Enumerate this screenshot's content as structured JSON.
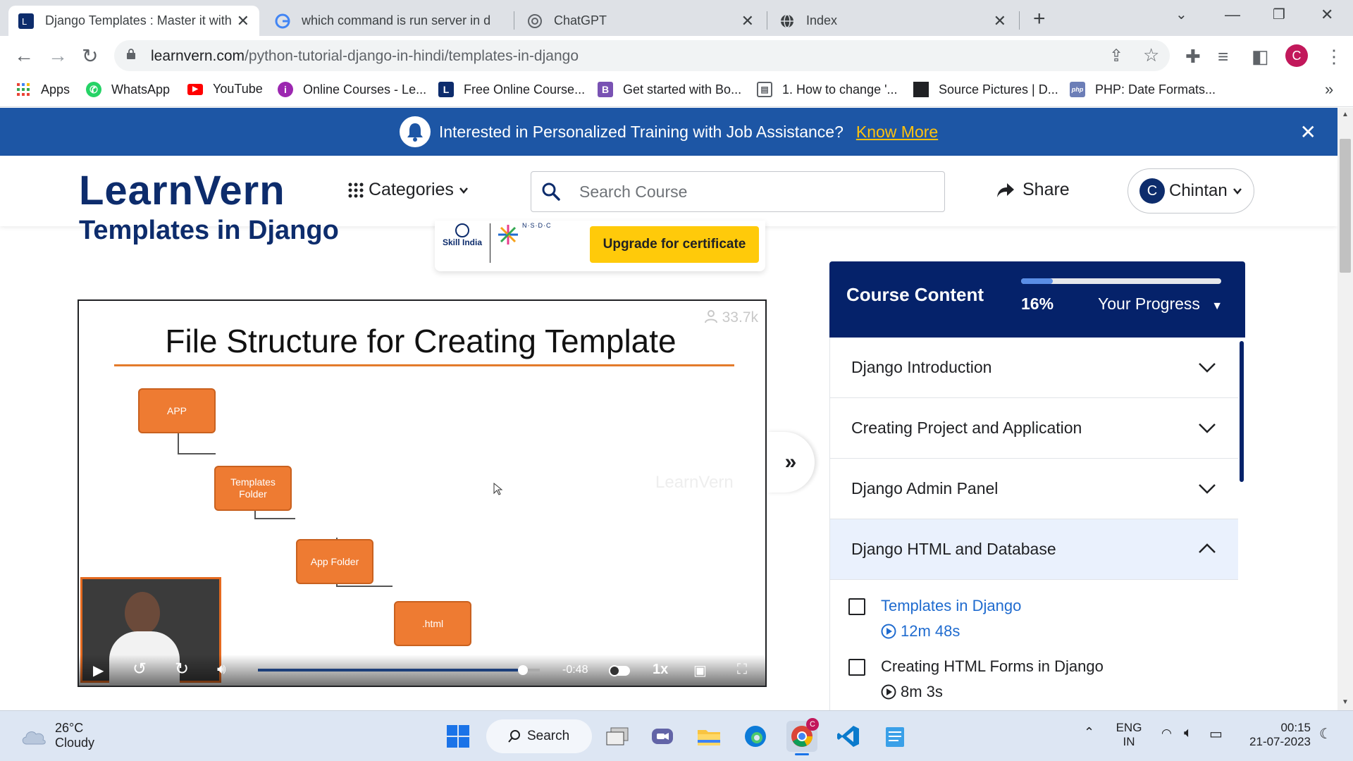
{
  "browser": {
    "tabs": [
      {
        "title": "Django Templates : Master it with",
        "active": true
      },
      {
        "title": "which command is run server in d",
        "active": false
      },
      {
        "title": "ChatGPT",
        "active": false
      },
      {
        "title": "Index",
        "active": false
      }
    ],
    "url_host": "learnvern.com",
    "url_path": "/python-tutorial-django-in-hindi/templates-in-django",
    "profile_initial": "C",
    "bookmarks": [
      {
        "label": "Apps"
      },
      {
        "label": "WhatsApp"
      },
      {
        "label": "YouTube"
      },
      {
        "label": "Online Courses - Le..."
      },
      {
        "label": "Free Online Course..."
      },
      {
        "label": "Get started with Bo..."
      },
      {
        "label": "1. How to change '..."
      },
      {
        "label": "Source Pictures | D..."
      },
      {
        "label": "PHP: Date Formats..."
      }
    ]
  },
  "banner": {
    "message": "Interested in Personalized Training with Job Assistance?",
    "link": "Know More"
  },
  "header": {
    "logo": "LearnVern",
    "categories": "Categories",
    "search_placeholder": "Search Course",
    "share": "Share",
    "user_initial": "C",
    "user_name": "Chintan"
  },
  "lesson": {
    "title": "Templates in Django",
    "cert_logos": {
      "skill_india": "Skill India",
      "nsdc": "N·S·D·C"
    },
    "upgrade_button": "Upgrade for certificate"
  },
  "video": {
    "slide_title": "File Structure for Creating Template",
    "boxes": [
      "APP",
      "Templates Folder",
      "App Folder",
      ".html"
    ],
    "views": "33.7k",
    "watermark": "LearnVern",
    "time_remaining": "-0:48",
    "speed": "1x",
    "progress": 0.94
  },
  "course_content": {
    "title": "Course Content",
    "progress_pct": "16%",
    "progress": 0.16,
    "your_progress": "Your Progress",
    "sections": [
      {
        "title": "Django Introduction",
        "open": false
      },
      {
        "title": "Creating Project and Application",
        "open": false
      },
      {
        "title": "Django Admin Panel",
        "open": false
      },
      {
        "title": "Django HTML and Database",
        "open": true
      }
    ],
    "lessons": [
      {
        "title": "Templates in Django",
        "duration": "12m 48s",
        "current": true
      },
      {
        "title": "Creating HTML Forms in Django",
        "duration": "8m 3s",
        "current": false
      }
    ]
  },
  "taskbar": {
    "temperature": "26°C",
    "weather": "Cloudy",
    "search": "Search",
    "lang": "ENG",
    "region": "IN",
    "time": "00:15",
    "date": "21-07-2023"
  },
  "colors": {
    "brand_navy": "#05226a",
    "banner_blue": "#1d56a5",
    "accent_yellow": "#ffca0a",
    "diagram_orange": "#ee7b32"
  }
}
